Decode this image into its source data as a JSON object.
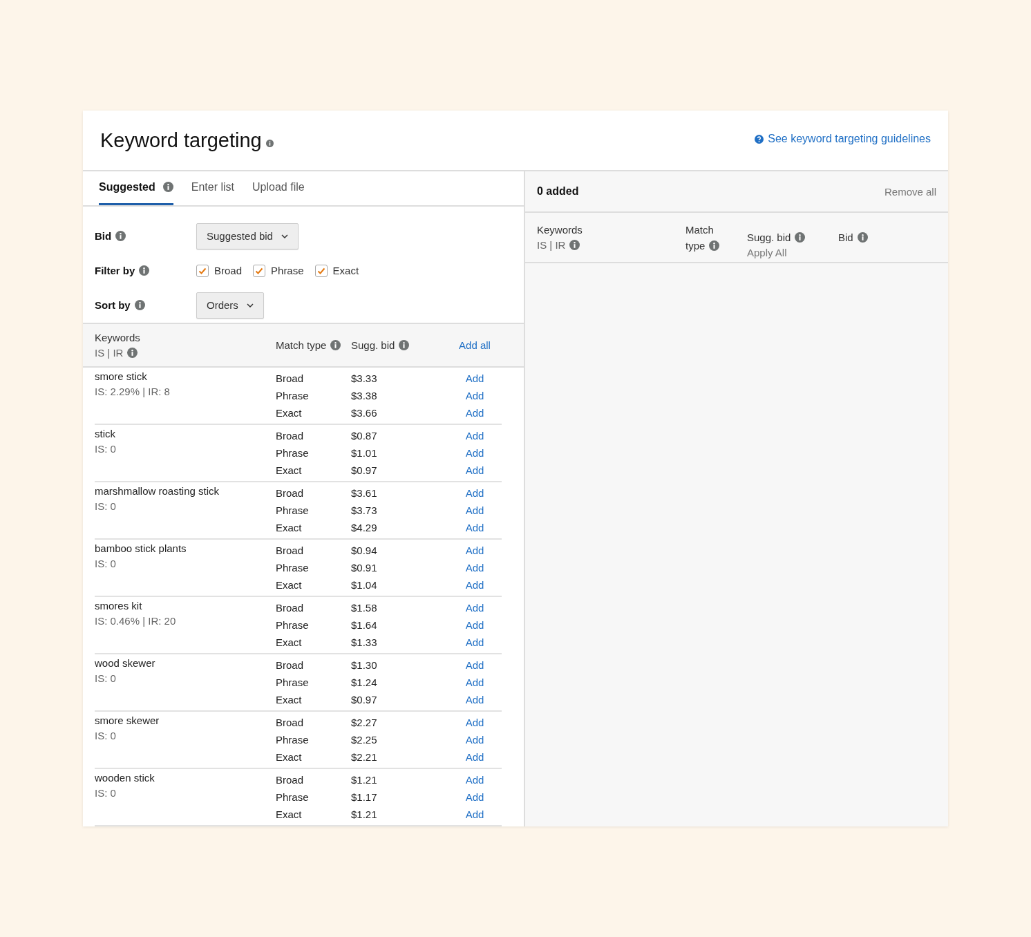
{
  "header": {
    "title": "Keyword targeting",
    "guidelines_link": "See keyword targeting guidelines"
  },
  "tabs": [
    {
      "label": "Suggested",
      "selected": true,
      "info": true
    },
    {
      "label": "Enter list",
      "selected": false,
      "info": false
    },
    {
      "label": "Upload file",
      "selected": false,
      "info": false
    }
  ],
  "settings": {
    "bid": {
      "label": "Bid",
      "value": "Suggested bid"
    },
    "filter": {
      "label": "Filter by",
      "options": [
        {
          "label": "Broad",
          "checked": true
        },
        {
          "label": "Phrase",
          "checked": true
        },
        {
          "label": "Exact",
          "checked": true
        }
      ]
    },
    "sort": {
      "label": "Sort by",
      "value": "Orders"
    }
  },
  "table": {
    "columns": {
      "keywords": "Keywords",
      "stats": "IS | IR",
      "match_type": "Match type",
      "sugg_bid": "Sugg. bid",
      "action": "Add all"
    },
    "rows": [
      {
        "keyword": "smore stick",
        "stats": "IS: 2.29% | IR: 8",
        "matches": [
          {
            "type": "Broad",
            "bid": "$3.33",
            "action": "Add"
          },
          {
            "type": "Phrase",
            "bid": "$3.38",
            "action": "Add"
          },
          {
            "type": "Exact",
            "bid": "$3.66",
            "action": "Add"
          }
        ]
      },
      {
        "keyword": "stick",
        "stats": "IS: 0",
        "matches": [
          {
            "type": "Broad",
            "bid": "$0.87",
            "action": "Add"
          },
          {
            "type": "Phrase",
            "bid": "$1.01",
            "action": "Add"
          },
          {
            "type": "Exact",
            "bid": "$0.97",
            "action": "Add"
          }
        ]
      },
      {
        "keyword": "marshmallow roasting stick",
        "stats": "IS: 0",
        "matches": [
          {
            "type": "Broad",
            "bid": "$3.61",
            "action": "Add"
          },
          {
            "type": "Phrase",
            "bid": "$3.73",
            "action": "Add"
          },
          {
            "type": "Exact",
            "bid": "$4.29",
            "action": "Add"
          }
        ]
      },
      {
        "keyword": "bamboo stick plants",
        "stats": "IS: 0",
        "matches": [
          {
            "type": "Broad",
            "bid": "$0.94",
            "action": "Add"
          },
          {
            "type": "Phrase",
            "bid": "$0.91",
            "action": "Add"
          },
          {
            "type": "Exact",
            "bid": "$1.04",
            "action": "Add"
          }
        ]
      },
      {
        "keyword": "smores kit",
        "stats": "IS: 0.46% | IR: 20",
        "matches": [
          {
            "type": "Broad",
            "bid": "$1.58",
            "action": "Add"
          },
          {
            "type": "Phrase",
            "bid": "$1.64",
            "action": "Add"
          },
          {
            "type": "Exact",
            "bid": "$1.33",
            "action": "Add"
          }
        ]
      },
      {
        "keyword": "wood skewer",
        "stats": "IS: 0",
        "matches": [
          {
            "type": "Broad",
            "bid": "$1.30",
            "action": "Add"
          },
          {
            "type": "Phrase",
            "bid": "$1.24",
            "action": "Add"
          },
          {
            "type": "Exact",
            "bid": "$0.97",
            "action": "Add"
          }
        ]
      },
      {
        "keyword": "smore skewer",
        "stats": "IS: 0",
        "matches": [
          {
            "type": "Broad",
            "bid": "$2.27",
            "action": "Add"
          },
          {
            "type": "Phrase",
            "bid": "$2.25",
            "action": "Add"
          },
          {
            "type": "Exact",
            "bid": "$2.21",
            "action": "Add"
          }
        ]
      },
      {
        "keyword": "wooden stick",
        "stats": "IS: 0",
        "matches": [
          {
            "type": "Broad",
            "bid": "$1.21",
            "action": "Add"
          },
          {
            "type": "Phrase",
            "bid": "$1.17",
            "action": "Add"
          },
          {
            "type": "Exact",
            "bid": "$1.21",
            "action": "Add"
          }
        ]
      }
    ]
  },
  "added_panel": {
    "count": "0 added",
    "remove_all": "Remove all",
    "columns": {
      "keywords": "Keywords",
      "stats": "IS | IR",
      "match_type": "Match type",
      "sugg_bid": "Sugg. bid",
      "apply_all": "Apply All",
      "bid": "Bid"
    }
  }
}
